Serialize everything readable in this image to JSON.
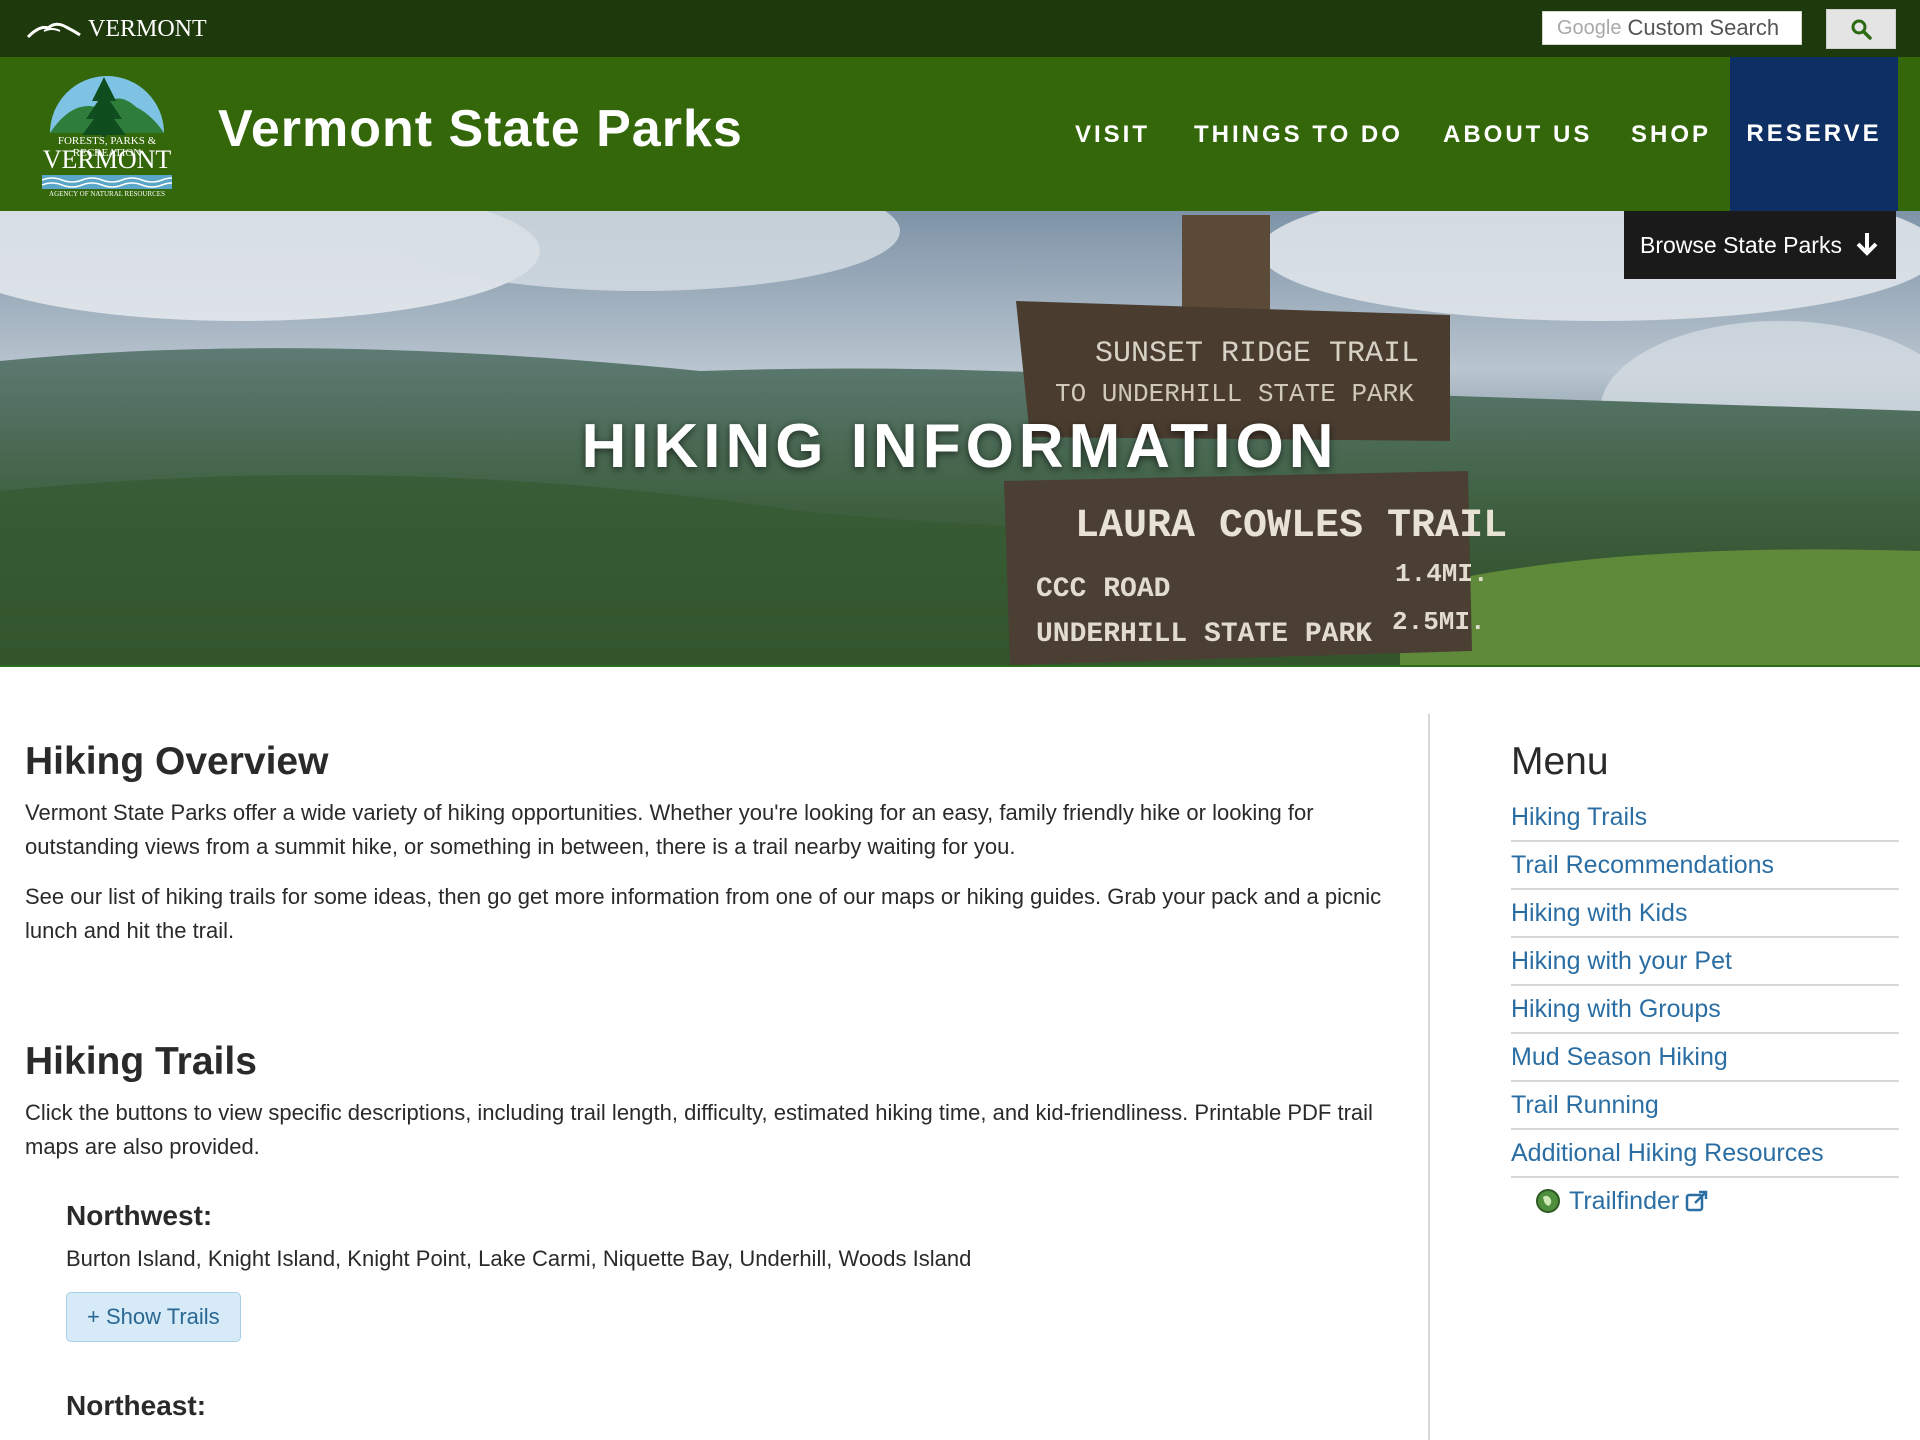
{
  "topbar": {
    "brand": "VERMONT",
    "search_google": "Google",
    "search_placeholder": "Custom Search"
  },
  "header": {
    "site_title": "Vermont State Parks",
    "logo_lines": [
      "FORESTS, PARKS & RECREATION",
      "VERMONT",
      "AGENCY OF NATURAL RESOURCES"
    ],
    "nav": [
      "VISIT",
      "THINGS TO DO",
      "ABOUT US",
      "SHOP"
    ],
    "reserve": "RESERVE"
  },
  "hero": {
    "title": "HIKING INFORMATION",
    "browse": "Browse State Parks",
    "sign_upper": [
      "SUNSET RIDGE TRAIL",
      "TO UNDERHILL STATE PARK"
    ],
    "sign_lower": [
      "LAURA COWLES TRAIL",
      "CCC ROAD",
      "1.4MI.",
      "UNDERHILL STATE PARK",
      "2.5MI."
    ]
  },
  "overview": {
    "heading": "Hiking Overview",
    "p1": "Vermont State Parks offer a wide variety of hiking opportunities. Whether you're looking for an easy, family friendly hike or looking for outstanding views from a summit hike, or something in between, there is a trail nearby waiting for you.",
    "p2": "See our list of hiking trails for some ideas, then go get more information from one of our maps or hiking guides. Grab your pack and a picnic lunch and hit the trail."
  },
  "trails": {
    "heading": "Hiking Trails",
    "intro": "Click the buttons to view specific descriptions, including trail length, difficulty, estimated hiking time, and kid-friendliness. Printable PDF trail maps are also provided.",
    "regions": [
      {
        "title": "Northwest:",
        "parks": "Burton Island, Knight Island, Knight Point, Lake Carmi, Niquette Bay, Underhill, Woods Island",
        "button": "+ Show Trails"
      },
      {
        "title": "Northeast:"
      }
    ]
  },
  "sidebar": {
    "heading": "Menu",
    "items": [
      "Hiking Trails",
      "Trail Recommendations",
      "Hiking with Kids",
      "Hiking with your Pet",
      "Hiking with Groups",
      "Mud Season Hiking",
      "Trail Running",
      "Additional Hiking Resources"
    ],
    "sub_item": "Trailfinder"
  },
  "colors": {
    "topbar": "#1e3a0c",
    "header": "#33670a",
    "reserve": "#0d2f63",
    "link": "#2b6ea3"
  },
  "icons": {
    "search": "search-icon",
    "browse_arrow": "arrow-down-icon",
    "external": "external-link-icon",
    "trailfinder": "globe-icon"
  }
}
